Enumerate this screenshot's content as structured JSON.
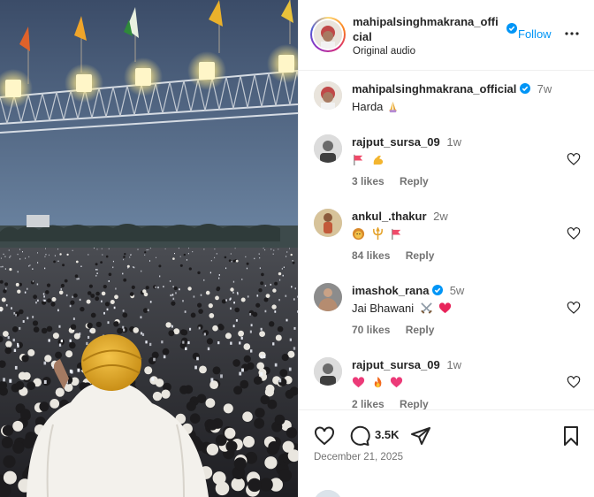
{
  "post": {
    "author": "mahipalsinghmakrana_official",
    "author_line1": "mahipalsinghmakrana_offi",
    "author_line2": "cial",
    "follow_label": "Follow",
    "subtitle": "Original audio",
    "more_icon": "more-horizontal-icon",
    "verified_color": "#0095f6"
  },
  "caption": {
    "username": "mahipalsinghmakrana_official",
    "time": "7w",
    "text": "Harda",
    "emojis": [
      "folded-hands"
    ]
  },
  "comments": [
    {
      "username": "rajput_sursa_09",
      "time": "1w",
      "text": "",
      "emojis": [
        "red-flag",
        "flexed-biceps"
      ],
      "likes": "3 likes",
      "reply": "Reply"
    },
    {
      "username": "ankul_.thakur",
      "time": "2w",
      "text": "",
      "emojis": [
        "lion",
        "trident",
        "red-flag"
      ],
      "likes": "84 likes",
      "reply": "Reply"
    },
    {
      "username": "imashok_rana",
      "verified": true,
      "time": "5w",
      "text": "Jai Bhawani",
      "emojis": [
        "crossed-swords",
        "red-heart"
      ],
      "likes": "70 likes",
      "reply": "Reply"
    },
    {
      "username": "rajput_sursa_09",
      "time": "1w",
      "text": "",
      "emojis": [
        "pink-heart",
        "fire",
        "pink-heart"
      ],
      "likes": "2 likes",
      "reply": "Reply"
    }
  ],
  "actions": {
    "like_icon": "heart-icon",
    "comment_icon": "comment-icon",
    "comment_count": "3.5K",
    "share_icon": "share-icon",
    "save_icon": "bookmark-icon",
    "date": "December 21, 2025"
  },
  "colors": {
    "accent": "#0095f6",
    "muted": "#737373",
    "text": "#262626"
  }
}
